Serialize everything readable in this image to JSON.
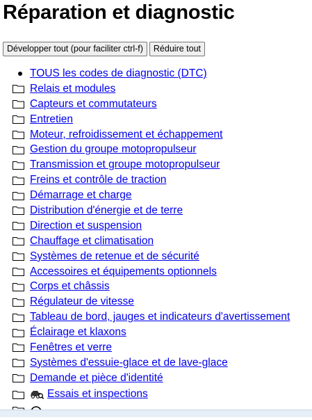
{
  "page": {
    "title": "Réparation et diagnostic"
  },
  "toolbar": {
    "expand_label": "Développer tout (pour faciliter ctrl-f)",
    "collapse_label": "Réduire tout"
  },
  "tree": {
    "items": [
      {
        "label": "TOUS les codes de diagnostic (DTC)",
        "icon": "bullet-icon"
      },
      {
        "label": "Relais et modules",
        "icon": "folder-icon"
      },
      {
        "label": "Capteurs et commutateurs",
        "icon": "folder-icon"
      },
      {
        "label": "Entretien",
        "icon": "folder-icon"
      },
      {
        "label": "Moteur, refroidissement et échappement",
        "icon": "folder-icon"
      },
      {
        "label": "Gestion du groupe motopropulseur",
        "icon": "folder-icon"
      },
      {
        "label": "Transmission et groupe motopropulseur",
        "icon": "folder-icon"
      },
      {
        "label": "Freins et contrôle de traction",
        "icon": "folder-icon"
      },
      {
        "label": "Démarrage et charge",
        "icon": "folder-icon"
      },
      {
        "label": "Distribution d'énergie et de terre",
        "icon": "folder-icon"
      },
      {
        "label": "Direction et suspension",
        "icon": "folder-icon"
      },
      {
        "label": "Chauffage et climatisation",
        "icon": "folder-icon"
      },
      {
        "label": "Systèmes de retenue et de sécurité",
        "icon": "folder-icon"
      },
      {
        "label": "Accessoires et équipements optionnels",
        "icon": "folder-icon"
      },
      {
        "label": "Corps et châssis",
        "icon": "folder-icon"
      },
      {
        "label": "Régulateur de vitesse",
        "icon": "folder-icon"
      },
      {
        "label": "Tableau de bord, jauges et indicateurs d'avertissement",
        "icon": "folder-icon"
      },
      {
        "label": "Éclairage et klaxons",
        "icon": "folder-icon"
      },
      {
        "label": "Fenêtres et verre",
        "icon": "folder-icon"
      },
      {
        "label": "Systèmes d'essuie-glace et de lave-glace",
        "icon": "folder-icon"
      },
      {
        "label": "Demande et pièce d'identité",
        "icon": "folder-icon"
      },
      {
        "label": "Essais et inspections",
        "icon": "car-inspection-icon"
      }
    ]
  }
}
